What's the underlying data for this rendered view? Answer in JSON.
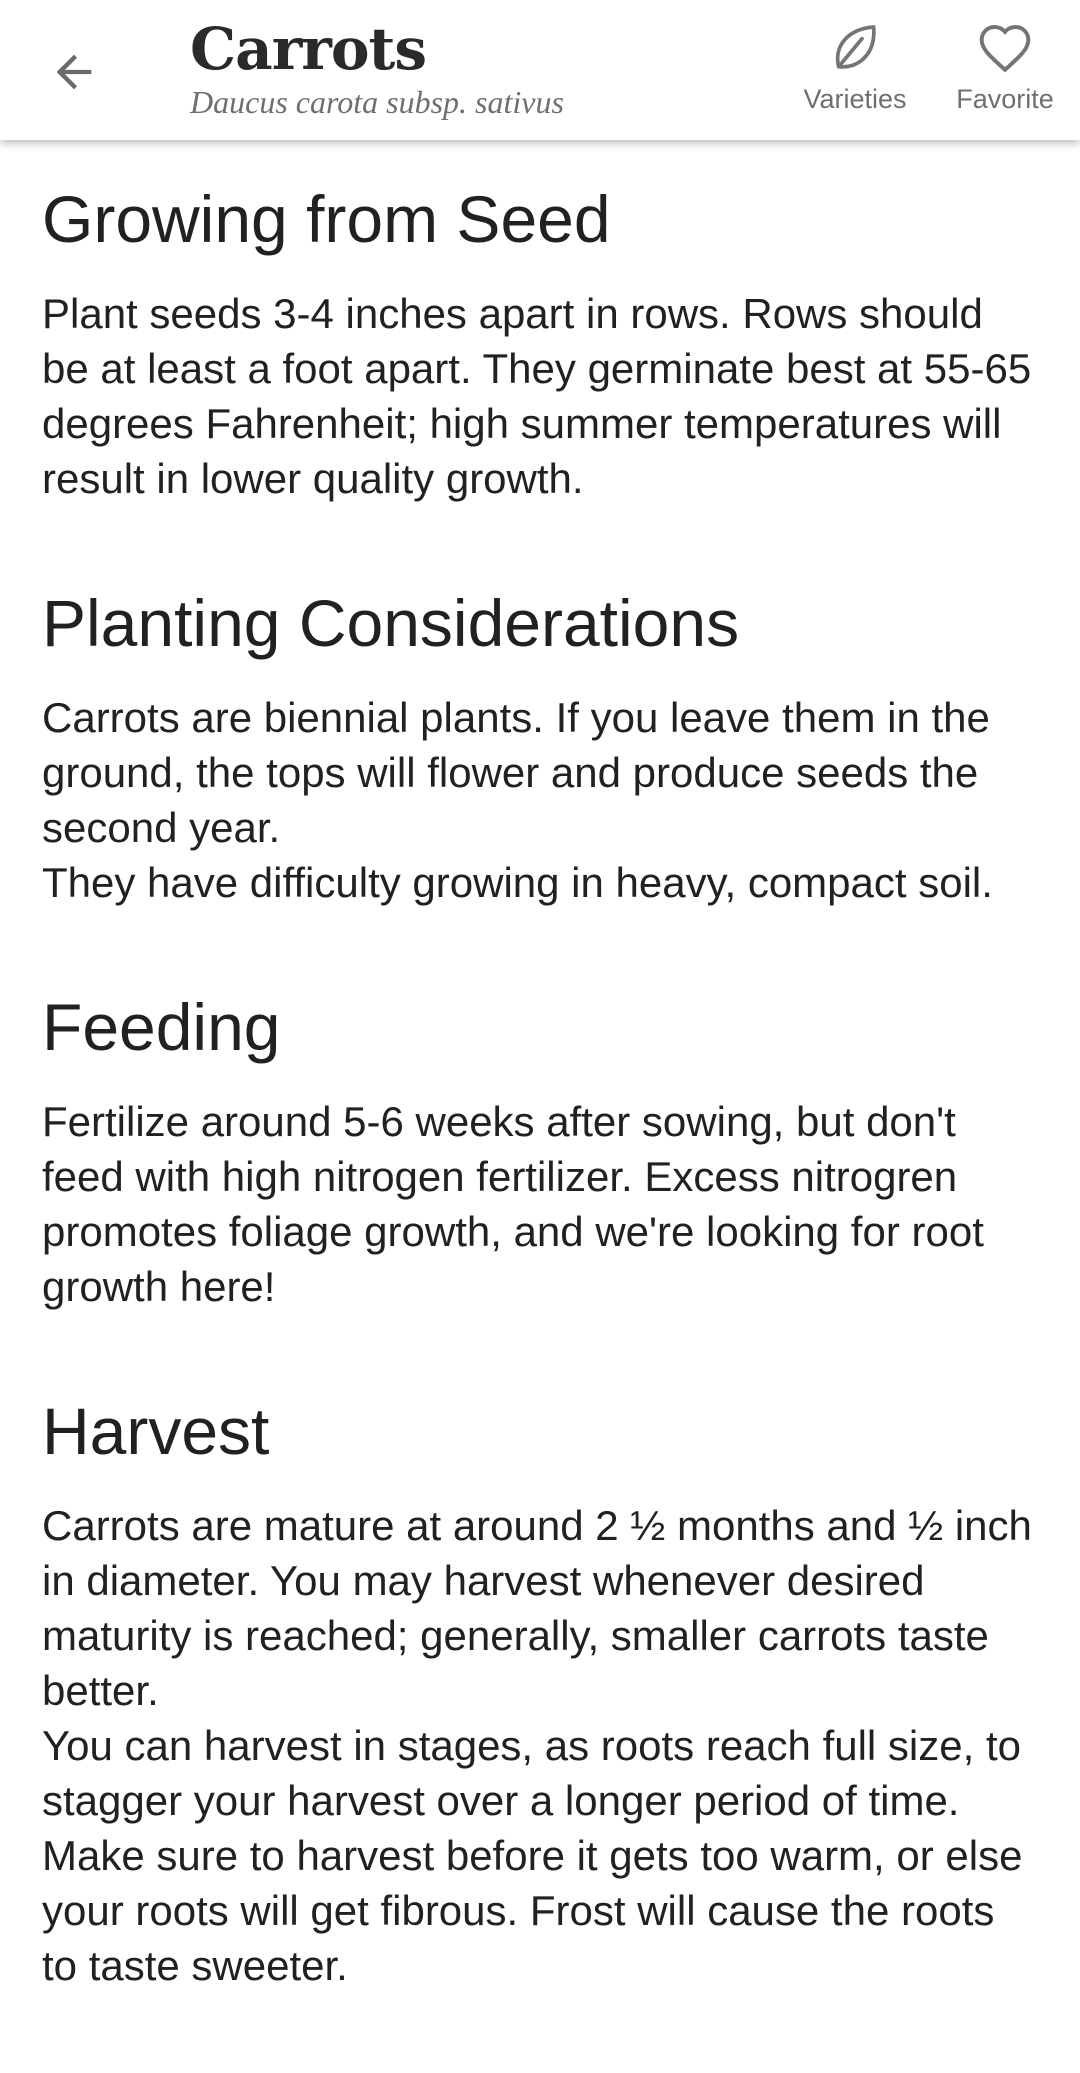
{
  "header": {
    "title": "Carrots",
    "subtitle": "Daucus carota subsp. sativus",
    "varieties_label": "Varieties",
    "favorite_label": "Favorite",
    "icons": {
      "back": "arrow-left-icon",
      "varieties": "leaf-icon",
      "favorite": "heart-outline-icon"
    }
  },
  "sections": [
    {
      "heading": "Growing from Seed",
      "paragraphs": [
        "Plant seeds 3-4 inches apart in rows. Rows should be at least a foot apart. They germinate best at 55-65 degrees Fahrenheit; high summer temperatures will result in lower quality growth."
      ]
    },
    {
      "heading": "Planting Considerations",
      "paragraphs": [
        "Carrots are biennial plants. If you leave them in the ground, the tops will flower and produce seeds the second year.",
        "They have difficulty growing in heavy, compact soil."
      ]
    },
    {
      "heading": "Feeding",
      "paragraphs": [
        "Fertilize around 5-6 weeks after sowing, but don't feed with high nitrogen fertilizer. Excess nitrogren promotes foliage growth, and we're looking for root growth here!"
      ]
    },
    {
      "heading": "Harvest",
      "paragraphs": [
        "Carrots are mature at around 2 ½ months and ½ inch in diameter. You may harvest whenever desired maturity is reached; generally, smaller carrots taste better.",
        "You can harvest in stages, as roots reach full size, to stagger your harvest over a longer period of time. Make sure to harvest before it gets too warm, or else your roots will get fibrous. Frost will cause the roots to taste sweeter."
      ]
    }
  ],
  "colors": {
    "text": "#212121",
    "muted": "#6f6f6f",
    "background": "#ffffff"
  }
}
